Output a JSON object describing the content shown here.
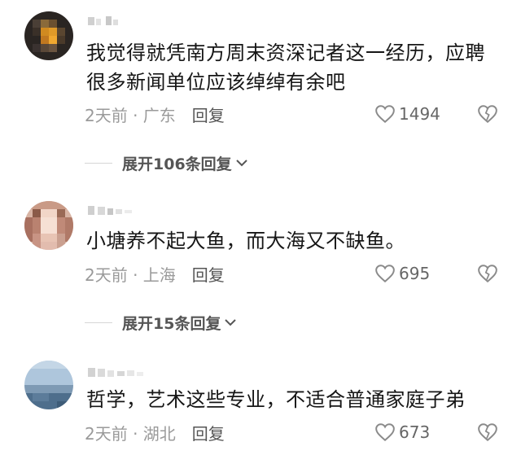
{
  "comments": [
    {
      "text": "我觉得就凭南方周末资深记者这一经历，应聘很多新闻单位应该绰绰有余吧",
      "time_location": "2天前 · 广东",
      "reply_label": "回复",
      "likes": "1494",
      "expand_label": "展开106条回复",
      "avatar_icon": "avatar-pixelated-dark"
    },
    {
      "text": "小塘养不起大鱼，而大海又不缺鱼。",
      "time_location": "2天前 · 上海",
      "reply_label": "回复",
      "likes": "695",
      "expand_label": "展开15条回复",
      "avatar_icon": "avatar-pixelated-portrait"
    },
    {
      "text": "哲学，艺术这些专业，不适合普通家庭子弟",
      "time_location": "2天前 · 湖北",
      "reply_label": "回复",
      "likes": "673",
      "avatar_icon": "avatar-pixelated-sky"
    }
  ],
  "colors": {
    "text_primary": "#161616",
    "text_secondary": "#9a9a9a",
    "text_action": "#555555",
    "divider": "#d6d6d6"
  }
}
